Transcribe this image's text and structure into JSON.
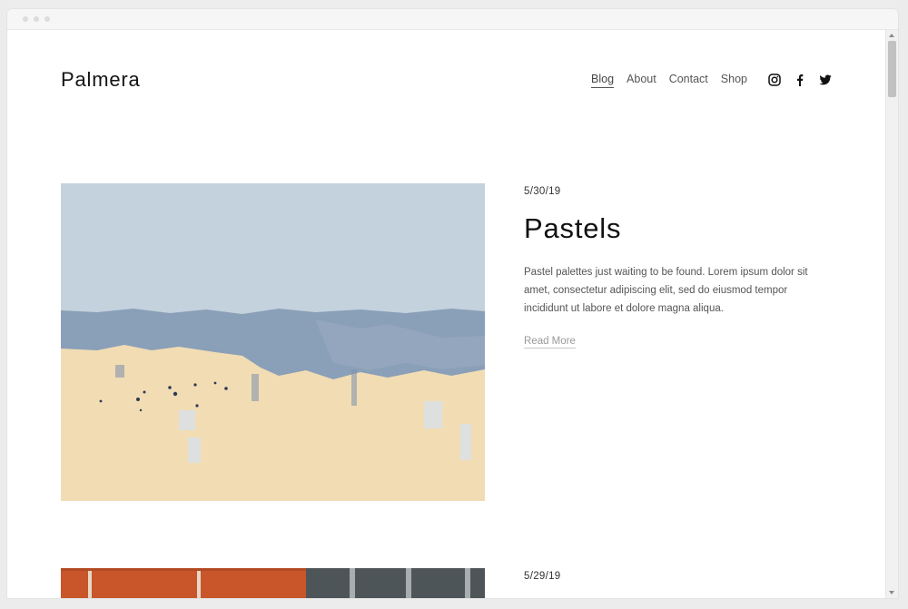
{
  "site": {
    "title": "Palmera"
  },
  "nav": {
    "items": [
      "Blog",
      "About",
      "Contact",
      "Shop"
    ]
  },
  "social": [
    "instagram-icon",
    "facebook-icon",
    "twitter-icon"
  ],
  "posts": [
    {
      "date": "5/30/19",
      "title": "Pastels",
      "excerpt": "Pastel palettes just waiting to be found. Lorem ipsum dolor sit amet, consectetur adipiscing elit, sed do eiusmod tempor incididunt ut labore et dolore magna aliqua.",
      "read_more": "Read More"
    },
    {
      "date": "5/29/19"
    }
  ],
  "colors": {
    "wall_top": "#c4d2dd",
    "wall_stripe": "#8a9fb8",
    "wall_bottom": "#f1dcb4",
    "brick": "#c8562a"
  }
}
